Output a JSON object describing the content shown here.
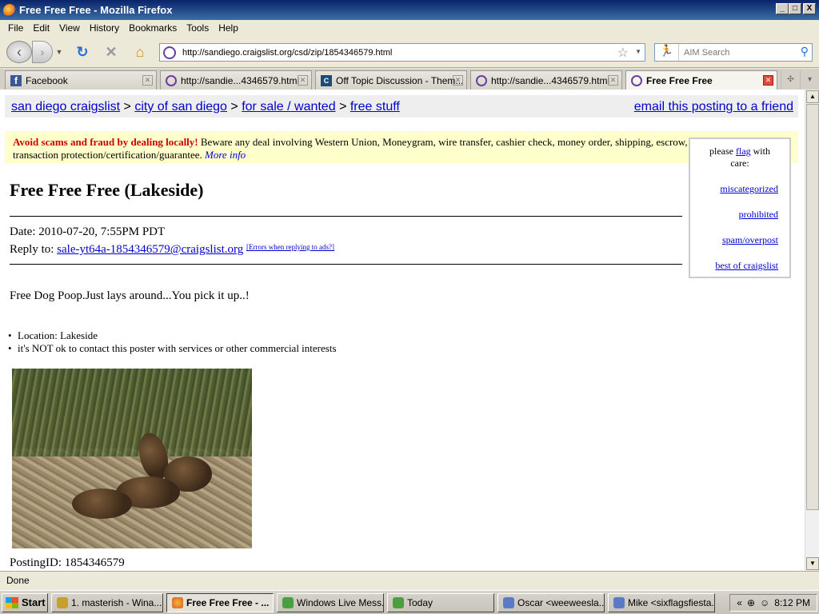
{
  "window": {
    "title": "Free Free Free - Mozilla Firefox",
    "min": "_",
    "max": "□",
    "close": "X"
  },
  "menu": [
    "File",
    "Edit",
    "View",
    "History",
    "Bookmarks",
    "Tools",
    "Help"
  ],
  "nav": {
    "url": "http://sandiego.craigslist.org/csd/zip/1854346579.html",
    "search_placeholder": "AIM Search"
  },
  "tabs": [
    {
      "label": "Facebook",
      "icon": "facebook-icon"
    },
    {
      "label": "http://sandie...4346579.html",
      "icon": "peace-icon"
    },
    {
      "label": "Off Topic Discussion - Them...",
      "icon": "cc-icon"
    },
    {
      "label": "http://sandie...4346579.html",
      "icon": "peace-icon"
    },
    {
      "label": "Free Free Free",
      "icon": "peace-icon",
      "active": true
    }
  ],
  "page": {
    "crumbs": {
      "c1": "san diego craigslist",
      "c2": "city of san diego",
      "c3": "for sale / wanted",
      "c4": "free stuff",
      "sep": ">",
      "email": "email this posting to a friend"
    },
    "scam": {
      "bold": "Avoid scams and fraud by dealing locally!",
      "text": " Beware any deal involving Western Union, Moneygram, wire transfer, cashier check, money order, shipping, escrow, or any promise of transaction protection/certification/guarantee. ",
      "more": "More info"
    },
    "flag": {
      "pre": "please ",
      "flag": "flag",
      "post": " with care:",
      "links": [
        "miscategorized",
        "prohibited",
        "spam/overpost",
        "best of craigslist"
      ]
    },
    "title": "Free Free Free (Lakeside)",
    "date": "Date: 2010-07-20, 7:55PM PDT",
    "reply_label": "Reply to: ",
    "reply_email": "sale-yt64a-1854346579@craigslist.org",
    "reply_errors": "[Errors when replying to ads?]",
    "body": "Free Dog Poop.Just lays around...You pick it up..!",
    "bullets": [
      "Location: Lakeside",
      "it's NOT ok to contact this poster with services or other commercial interests"
    ],
    "posting_id": "PostingID: 1854346579"
  },
  "status": "Done",
  "taskbar": {
    "start": "Start",
    "items": [
      "1. masterish - Wina...",
      "Free Free Free - ...",
      "Windows Live Mess...",
      "Today",
      "Oscar <weeweesla...",
      "Mike <sixflagsfiesta..."
    ],
    "time": "8:12 PM",
    "chev": "«"
  }
}
